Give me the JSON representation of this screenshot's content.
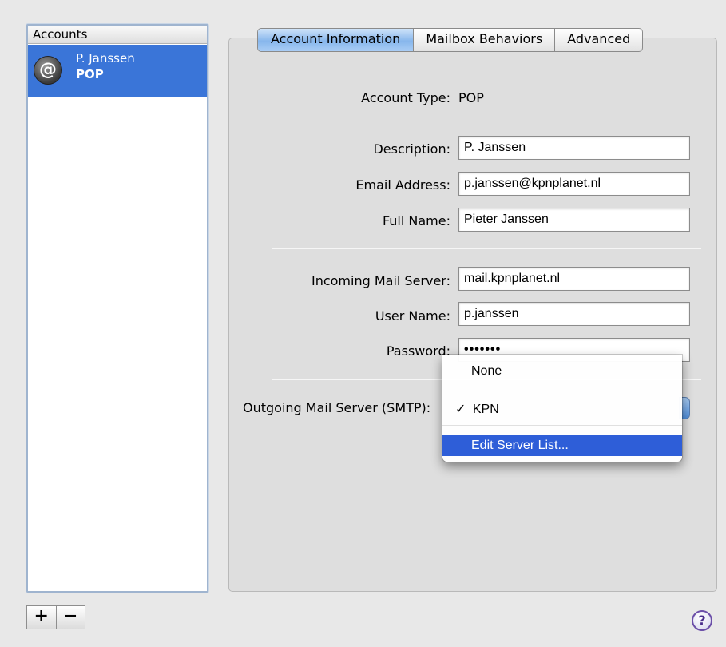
{
  "accounts": {
    "header": "Accounts",
    "items": [
      {
        "name": "P. Janssen",
        "type": "POP",
        "icon": "at-sign-icon"
      }
    ],
    "add_label": "+",
    "remove_label": "−"
  },
  "tabs": [
    {
      "label": "Account Information",
      "active": true
    },
    {
      "label": "Mailbox Behaviors",
      "active": false
    },
    {
      "label": "Advanced",
      "active": false
    }
  ],
  "form": {
    "account_type_label": "Account Type:",
    "account_type_value": "POP",
    "description_label": "Description:",
    "description_value": "P. Janssen",
    "email_label": "Email Address:",
    "email_value": "p.janssen@kpnplanet.nl",
    "fullname_label": "Full Name:",
    "fullname_value": "Pieter Janssen",
    "incoming_label": "Incoming Mail Server:",
    "incoming_value": "mail.kpnplanet.nl",
    "username_label": "User Name:",
    "username_value": "p.janssen",
    "password_label": "Password:",
    "password_value": "•••••••",
    "smtp_label": "Outgoing Mail Server (SMTP):"
  },
  "smtp_menu": {
    "items": [
      {
        "label": "None",
        "checked": false
      },
      {
        "label": "KPN",
        "checked": true
      },
      {
        "label": "Edit Server List...",
        "highlighted": true
      }
    ],
    "check_mark": "✓"
  },
  "help_label": "?"
}
